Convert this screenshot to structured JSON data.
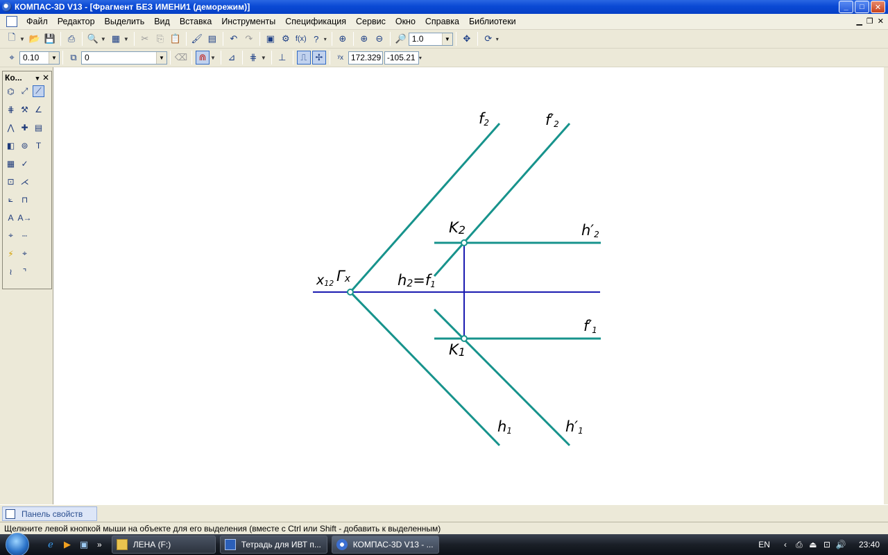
{
  "window": {
    "title": "КОМПАС-3D V13 - [Фрагмент БЕЗ ИМЕНИ1 (деморежим)]",
    "buttons": [
      "_",
      "□",
      "✕"
    ]
  },
  "menu": {
    "items": [
      "Файл",
      "Редактор",
      "Выделить",
      "Вид",
      "Вставка",
      "Инструменты",
      "Спецификация",
      "Сервис",
      "Окно",
      "Справка",
      "Библиотеки"
    ]
  },
  "toolbar1": {
    "zoom_value": "1.0"
  },
  "toolbar2": {
    "step_value": "0.10",
    "layer_value": "0",
    "coord_x": "172.329",
    "coord_y": "-105.21"
  },
  "compact_panel": {
    "title": "Ко..."
  },
  "drawing": {
    "labels": {
      "f2": "f",
      "f2_sub": "2",
      "f2p": "f′",
      "f2p_sub": "2",
      "k2": "K",
      "k2_sub": "2",
      "h2p": "h′",
      "h2p_sub": "2",
      "x12": "x",
      "x12_sub": "12",
      "gx": "Г",
      "gx_sub": "x",
      "h2f1_a": "h",
      "h2f1_a_sub": "2",
      "h2f1_b": "=f",
      "h2f1_b_sub": "1",
      "f1p": "f′",
      "f1p_sub": "1",
      "k1": "K",
      "k1_sub": "1",
      "h1": "h",
      "h1_sub": "1",
      "h1p": "h′",
      "h1p_sub": "1"
    },
    "colors": {
      "teal": "#17938c",
      "blue": "#1a1ab0"
    }
  },
  "property_panel": {
    "tab_label": "Панель свойств"
  },
  "status": {
    "text": "Щелкните левой кнопкой мыши на объекте для его выделения (вместе с Ctrl или Shift - добавить к выделенным)"
  },
  "taskbar": {
    "tasks": [
      {
        "label": "ЛЕНА (F:)"
      },
      {
        "label": "Тетрадь для ИВТ п..."
      },
      {
        "label": "КОМПАС-3D V13 - ..."
      }
    ],
    "lang": "EN",
    "clock": "23:40"
  }
}
